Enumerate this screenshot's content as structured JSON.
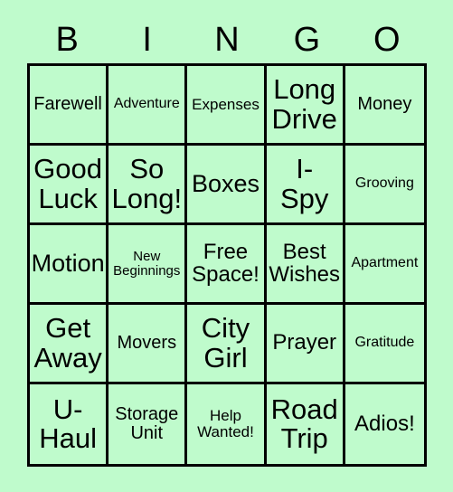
{
  "card": {
    "title": "BINGO",
    "background_color": "#bffbcc",
    "border_color": "#000000",
    "text_color": "#000000"
  },
  "header": {
    "letters": [
      "B",
      "I",
      "N",
      "G",
      "O"
    ]
  },
  "grid": {
    "rows": 5,
    "columns": 5,
    "cells": [
      {
        "text": "Farewell",
        "size": "sm"
      },
      {
        "text": "Adventure",
        "size": "xxs"
      },
      {
        "text": "Expenses",
        "size": "xs"
      },
      {
        "text": "Long\nDrive",
        "size": "xl"
      },
      {
        "text": "Money",
        "size": "sm"
      },
      {
        "text": "Good\nLuck",
        "size": "xl"
      },
      {
        "text": "So\nLong!",
        "size": "xl"
      },
      {
        "text": "Boxes",
        "size": "lg"
      },
      {
        "text": "I-\nSpy",
        "size": "xl"
      },
      {
        "text": "Grooving",
        "size": "xxs"
      },
      {
        "text": "Motion",
        "size": "lg"
      },
      {
        "text": "New\nBeginnings",
        "size": "tiny"
      },
      {
        "text": "Free\nSpace!",
        "size": "md"
      },
      {
        "text": "Best\nWishes",
        "size": "md"
      },
      {
        "text": "Apartment",
        "size": "xxs"
      },
      {
        "text": "Get\nAway",
        "size": "xl"
      },
      {
        "text": "Movers",
        "size": "sm"
      },
      {
        "text": "City\nGirl",
        "size": "xl"
      },
      {
        "text": "Prayer",
        "size": "md"
      },
      {
        "text": "Gratitude",
        "size": "xxs"
      },
      {
        "text": "U-\nHaul",
        "size": "xl"
      },
      {
        "text": "Storage\nUnit",
        "size": "sm"
      },
      {
        "text": "Help\nWanted!",
        "size": "xs"
      },
      {
        "text": "Road\nTrip",
        "size": "xl"
      },
      {
        "text": "Adios!",
        "size": "md"
      }
    ]
  }
}
